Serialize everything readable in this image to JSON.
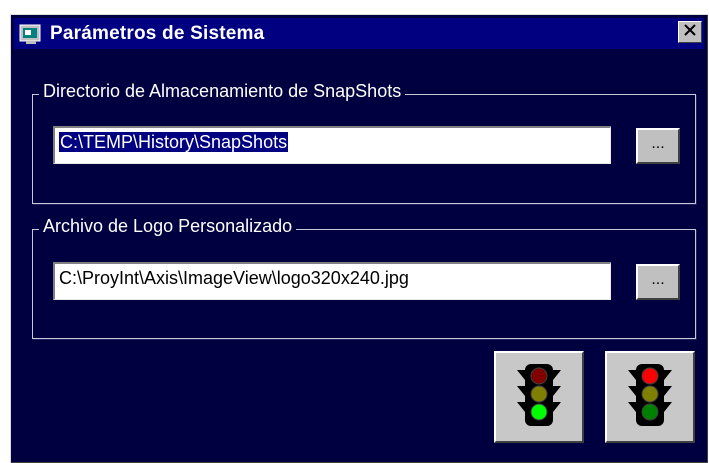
{
  "window": {
    "title": "Parámetros de Sistema",
    "close_label": "✕"
  },
  "snapshots_group": {
    "legend": "Directorio de Almacenamiento de SnapShots",
    "path_value": "C:\\TEMP\\History\\SnapShots",
    "browse_label": "..."
  },
  "logo_group": {
    "legend": "Archivo de Logo Personalizado",
    "path_value": "C:\\ProyInt\\Axis\\ImageView\\logo320x240.jpg",
    "browse_label": "..."
  },
  "actions": {
    "accept_icon": "traffic-light-green-icon",
    "cancel_icon": "traffic-light-red-icon"
  },
  "colors": {
    "dialog_background": "#000040",
    "titlebar": "#000080",
    "selection": "#000080",
    "light_red": "#ff0000",
    "light_yellow": "#808000",
    "light_green": "#00ff00"
  }
}
